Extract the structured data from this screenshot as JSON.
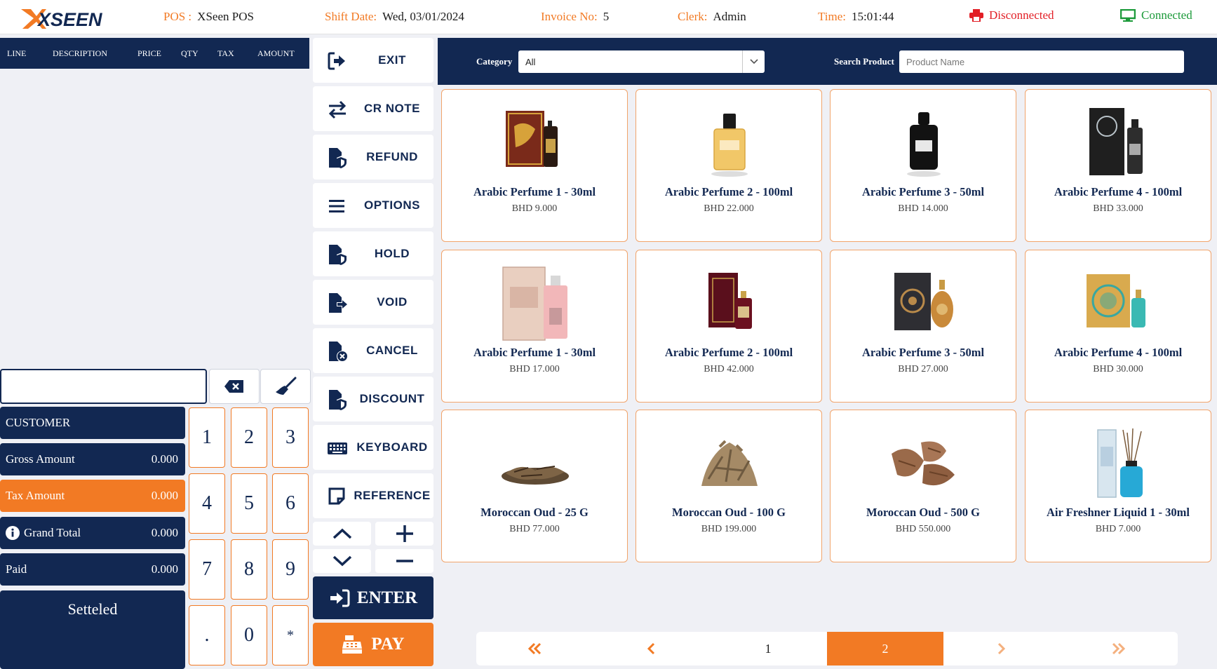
{
  "header": {
    "brand": "XSEEN",
    "pos_label": "POS :",
    "pos_value": "XSeen POS",
    "shift_label": "Shift Date:",
    "shift_value": "Wed, 03/01/2024",
    "invoice_label": "Invoice No:",
    "invoice_value": "5",
    "clerk_label": "Clerk:",
    "clerk_value": "Admin",
    "time_label": "Time:",
    "time_value": "15:01:44",
    "printer_status": "Disconnected",
    "display_status": "Connected"
  },
  "cart": {
    "columns": [
      "LINE",
      "DESCRIPTION",
      "PRICE",
      "QTY",
      "TAX",
      "AMOUNT"
    ]
  },
  "entry": {
    "value": ""
  },
  "summary": {
    "customer_label": "CUSTOMER",
    "gross_label": "Gross Amount",
    "gross_value": "0.000",
    "tax_label": "Tax Amount",
    "tax_value": "0.000",
    "grand_label": "Grand Total",
    "grand_value": "0.000",
    "paid_label": "Paid",
    "paid_value": "0.000",
    "status": "Setteled"
  },
  "keypad": [
    "1",
    "2",
    "3",
    "4",
    "5",
    "6",
    "7",
    "8",
    "9",
    ".",
    "0",
    "*"
  ],
  "actions": {
    "exit": "EXIT",
    "cr_note": "CR NOTE",
    "refund": "REFUND",
    "options": "OPTIONS",
    "hold": "HOLD",
    "void": "VOID",
    "cancel": "CANCEL",
    "discount": "DISCOUNT",
    "keyboard": "KEYBOARD",
    "reference": "REFERENCE",
    "enter": "ENTER",
    "pay": "PAY"
  },
  "filter": {
    "category_label": "Category",
    "category_value": "All",
    "search_label": "Search Product",
    "search_placeholder": "Product Name"
  },
  "products": [
    {
      "name": "Arabic Perfume 1 - 30ml",
      "price": "BHD 9.000",
      "icon": "perfume-box-gold-icon"
    },
    {
      "name": "Arabic Perfume 2 - 100ml",
      "price": "BHD 22.000",
      "icon": "perfume-bottle-amber-icon"
    },
    {
      "name": "Arabic Perfume 3 - 50ml",
      "price": "BHD 14.000",
      "icon": "perfume-bottle-black-icon"
    },
    {
      "name": "Arabic Perfume 4 - 100ml",
      "price": "BHD 33.000",
      "icon": "perfume-box-black-icon"
    },
    {
      "name": "Arabic Perfume 1 - 30ml",
      "price": "BHD 17.000",
      "icon": "perfume-box-pink-icon"
    },
    {
      "name": "Arabic Perfume 2 - 100ml",
      "price": "BHD 42.000",
      "icon": "perfume-box-maroon-icon"
    },
    {
      "name": "Arabic Perfume 3 - 50ml",
      "price": "BHD 27.000",
      "icon": "perfume-box-dark-icon"
    },
    {
      "name": "Arabic Perfume 4 - 100ml",
      "price": "BHD 30.000",
      "icon": "perfume-box-teal-icon"
    },
    {
      "name": "Moroccan Oud - 25 G",
      "price": "BHD 77.000",
      "icon": "oud-chips-small-icon"
    },
    {
      "name": "Moroccan Oud - 100 G",
      "price": "BHD 199.000",
      "icon": "oud-chips-pile-icon"
    },
    {
      "name": "Moroccan Oud - 500 G",
      "price": "BHD 550.000",
      "icon": "oud-pieces-large-icon"
    },
    {
      "name": "Air Freshner Liquid 1 - 30ml",
      "price": "BHD 7.000",
      "icon": "reed-diffuser-icon"
    }
  ],
  "pager": {
    "page1": "1",
    "page2": "2",
    "active": "2"
  },
  "colors": {
    "navy": "#122852",
    "orange": "#f27a24",
    "red": "#e21f26",
    "green": "#1c9a3a"
  }
}
